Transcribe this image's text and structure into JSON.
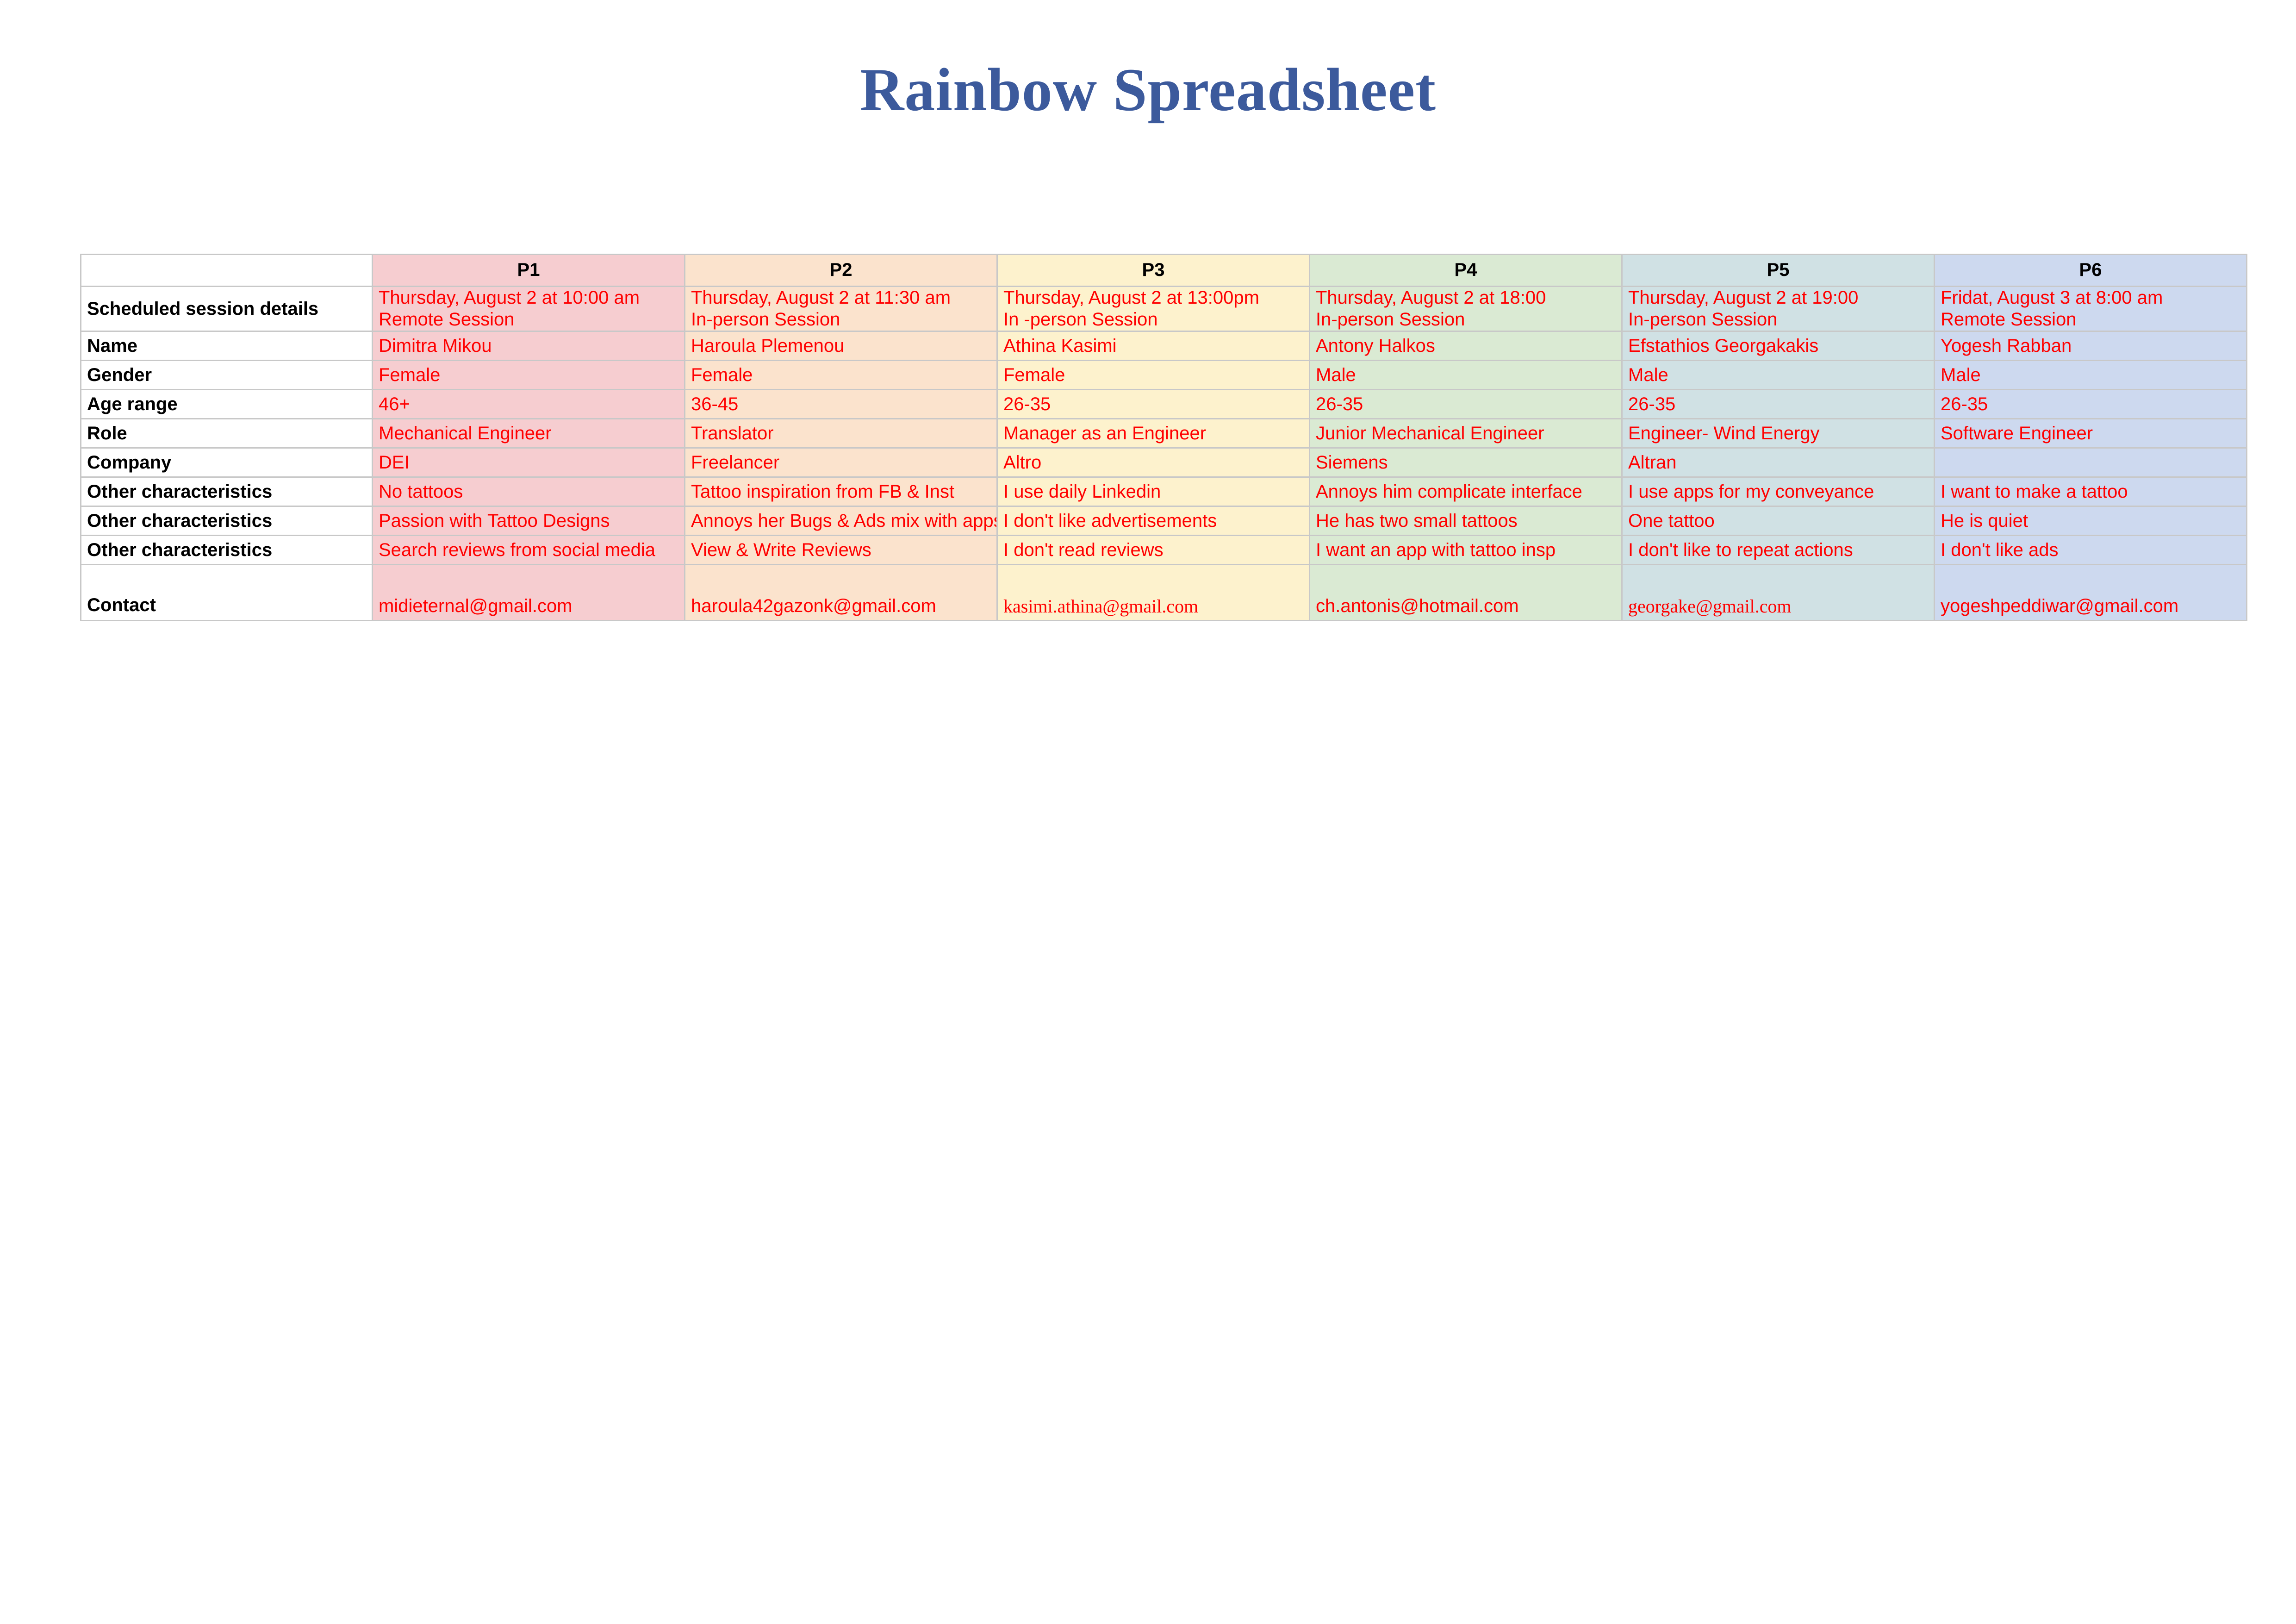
{
  "document": {
    "title": "Rainbow Spreadsheet"
  },
  "table": {
    "corner_label": "",
    "participant_headers": [
      "P1",
      "P2",
      "P3",
      "P4",
      "P5",
      "P6"
    ],
    "row_labels": [
      "Scheduled session details",
      "Name",
      "Gender",
      "Age range",
      "Role",
      "Company",
      "Other characteristics",
      "Other characteristics",
      "Other characteristics",
      "Contact"
    ],
    "column_colors": {
      "p1": "#f6cdd0",
      "p2": "#fbe3cd",
      "p3": "#fdf2cd",
      "p4": "#daead3",
      "p5": "#d0e1e4",
      "p6": "#cdd9ef"
    },
    "value_text_color": "#ff0000",
    "title_color": "#3c5a9c",
    "participants": [
      {
        "id": "P1",
        "session_line1": "Thursday, August 2 at 10:00 am",
        "session_line2": "Remote Session",
        "name": "Dimitra Mikou",
        "gender": "Female",
        "age_range": "46+",
        "role": "Mechanical Engineer",
        "company": "DEI",
        "other1": "No tattoos",
        "other2": "Passion with Tattoo Designs",
        "other3": "Search reviews from social media",
        "contact": "midieternal@gmail.com"
      },
      {
        "id": "P2",
        "session_line1": "Thursday, August 2 at 11:30 am",
        "session_line2": "In-person Session",
        "name": "Haroula Plemenou",
        "gender": "Female",
        "age_range": "36-45",
        "role": "Translator",
        "company": "Freelancer",
        "other1": "Tattoo inspiration from FB & Inst",
        "other2": "Annoys her Bugs & Ads mix with apps",
        "other3": "View & Write Reviews",
        "contact": "haroula42gazonk@gmail.com"
      },
      {
        "id": "P3",
        "session_line1": "Thursday, August 2 at 13:00pm",
        "session_line2": "In -person Session",
        "name": "Athina Kasimi",
        "gender": "Female",
        "age_range": "26-35",
        "role": "Manager as an Engineer",
        "company": "Altro",
        "other1": "I use daily Linkedin",
        "other2": "I don't like advertisements",
        "other3": "I don't read reviews",
        "contact": "kasimi.athina@gmail.com"
      },
      {
        "id": "P4",
        "session_line1": "Thursday, August 2 at 18:00",
        "session_line2": "In-person Session",
        "name": "Antony Halkos",
        "gender": "Male",
        "age_range": "26-35",
        "role": "Junior Mechanical Engineer",
        "company": "Siemens",
        "other1": "Annoys him complicate interface",
        "other2": "He has two small tattoos",
        "other3": "I want an app with tattoo insp",
        "contact": "ch.antonis@hotmail.com"
      },
      {
        "id": "P5",
        "session_line1": "Thursday, August 2 at 19:00",
        "session_line2": "In-person Session",
        "name": "Efstathios Georgakakis",
        "gender": "Male",
        "age_range": "26-35",
        "role": "Engineer- Wind Energy",
        "company": "Altran",
        "other1": "I use apps for my conveyance",
        "other2": "One tattoo",
        "other3": "I don't like to repeat actions",
        "contact": "georgake@gmail.com"
      },
      {
        "id": "P6",
        "session_line1": "Fridat, August 3 at 8:00 am",
        "session_line2": "Remote Session",
        "name": "Yogesh Rabban",
        "gender": "Male",
        "age_range": "26-35",
        "role": "Software Engineer",
        "company": "",
        "other1": "I want to make a tattoo",
        "other2": "He is quiet",
        "other3": "I don't like ads",
        "contact": "yogeshpeddiwar@gmail.com"
      }
    ]
  }
}
